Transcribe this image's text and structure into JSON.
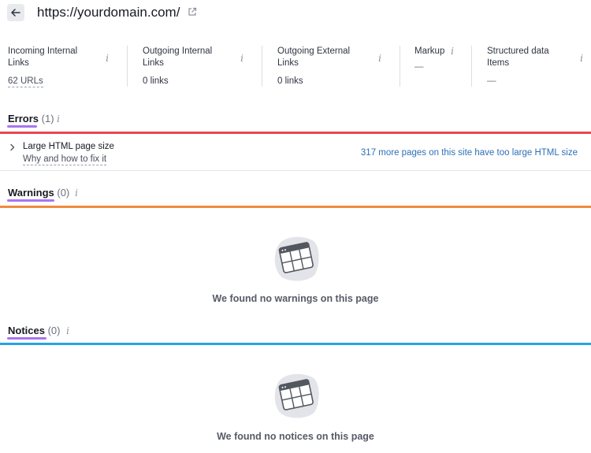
{
  "header": {
    "back_label": "Back",
    "url": "https://yourdomain.com/"
  },
  "metrics": [
    {
      "label_line1": "Incoming Internal",
      "label_line2": "Links",
      "value": "62 URLs"
    },
    {
      "label_line1": "Outgoing Internal",
      "label_line2": "Links",
      "value": "0 links"
    },
    {
      "label_line1": "Outgoing External",
      "label_line2": "Links",
      "value": "0 links"
    },
    {
      "label_line1": "Markup",
      "label_line2": "",
      "value": "—"
    },
    {
      "label_line1": "Structured data",
      "label_line2": "Items",
      "value": "—"
    }
  ],
  "errors": {
    "title": "Errors",
    "count": "(1)",
    "bar_color": "#e8464f",
    "issue": {
      "title": "Large HTML page size",
      "fix_link": "Why and how to fix it",
      "more_link": "317 more pages on this site have too large HTML size"
    }
  },
  "warnings": {
    "title": "Warnings",
    "count": "(0)",
    "bar_color": "#f08a3e",
    "empty_text": "We found no warnings on this page"
  },
  "notices": {
    "title": "Notices",
    "count": "(0)",
    "bar_color": "#27a3e3",
    "empty_text": "We found no notices on this page"
  },
  "colors": {
    "accent_underline": "#a875f0",
    "link": "#2d6fb6"
  }
}
